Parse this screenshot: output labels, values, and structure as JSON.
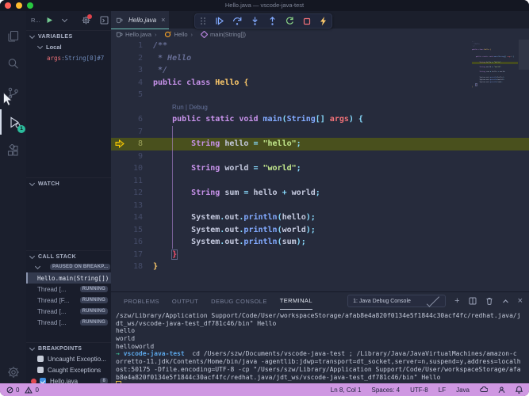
{
  "title_bar": {
    "title": "Hello.java — vscode-java-test"
  },
  "colors": {
    "status_bar_debugging": "#cf97e2",
    "active_tab_accent": "#6fc2b5",
    "current_line_highlight": "#49501d",
    "breakpoint_red": "#e04a52",
    "activity_badge_teal": "#2bbc9c"
  },
  "activity_bar": {
    "debug_badge": "1"
  },
  "sidebar": {
    "toolbar": {
      "label": "R..."
    },
    "variables": {
      "header": "VARIABLES",
      "scope_label": "Local",
      "entries": [
        {
          "name": "args",
          "sep": ": ",
          "value": "String[0]#7"
        }
      ]
    },
    "watch": {
      "header": "WATCH"
    },
    "call_stack": {
      "header": "CALL STACK",
      "session_badge": "PAUSED ON BREAKP...",
      "frame_label": "Hello.main(String[])",
      "threads": [
        {
          "label": "Thread [...",
          "status": "RUNNING"
        },
        {
          "label": "Thread [F...",
          "status": "RUNNING"
        },
        {
          "label": "Thread [...",
          "status": "RUNNING"
        },
        {
          "label": "Thread [...",
          "status": "RUNNING"
        }
      ]
    },
    "breakpoints": {
      "header": "BREAKPOINTS",
      "items": [
        {
          "label": "Uncaught Exceptio...",
          "checked": false
        },
        {
          "label": "Caught Exceptions",
          "checked": false
        },
        {
          "label": "Hello.java",
          "checked": true,
          "dot": true,
          "badge": "8"
        }
      ]
    }
  },
  "editor": {
    "tab": {
      "label": "Hello.java"
    },
    "breadcrumb": [
      "Hello.java",
      "Hello",
      "main(String[])"
    ],
    "code": {
      "lines": [
        {
          "num": 1,
          "tokens": [
            {
              "t": "/**",
              "c": "cm"
            }
          ]
        },
        {
          "num": 2,
          "tokens": [
            {
              "t": " * Hello",
              "c": "cm"
            }
          ]
        },
        {
          "num": 3,
          "tokens": [
            {
              "t": " */",
              "c": "cm"
            }
          ]
        },
        {
          "num": 4,
          "tokens": [
            {
              "t": "public class ",
              "c": "kw"
            },
            {
              "t": "Hello ",
              "c": "cls"
            },
            {
              "t": "{",
              "c": "cls"
            }
          ]
        },
        {
          "num": 5,
          "tokens": []
        },
        {
          "lens": true,
          "text": "Run | Debug"
        },
        {
          "num": 6,
          "tokens": [
            {
              "t": "    ",
              "c": "pl"
            },
            {
              "t": "public static void ",
              "c": "kw"
            },
            {
              "t": "main",
              "c": "fn"
            },
            {
              "t": "(",
              "c": "op"
            },
            {
              "t": "String",
              "c": "fn"
            },
            {
              "t": "[] ",
              "c": "op"
            },
            {
              "t": "args",
              "c": "pr"
            },
            {
              "t": ") {",
              "c": "op"
            }
          ]
        },
        {
          "num": 7,
          "tokens": []
        },
        {
          "num": 8,
          "hl": true,
          "tokens": [
            {
              "t": "        ",
              "c": "pl"
            },
            {
              "t": "String ",
              "c": "kw"
            },
            {
              "t": "hello ",
              "c": "pl"
            },
            {
              "t": "= ",
              "c": "op"
            },
            {
              "t": "\"hello\"",
              "c": "str"
            },
            {
              "t": ";",
              "c": "op"
            }
          ]
        },
        {
          "num": 9,
          "tokens": []
        },
        {
          "num": 10,
          "tokens": [
            {
              "t": "        ",
              "c": "pl"
            },
            {
              "t": "String ",
              "c": "kw"
            },
            {
              "t": "world ",
              "c": "pl"
            },
            {
              "t": "= ",
              "c": "op"
            },
            {
              "t": "\"world\"",
              "c": "str"
            },
            {
              "t": ";",
              "c": "op"
            }
          ]
        },
        {
          "num": 11,
          "tokens": []
        },
        {
          "num": 12,
          "tokens": [
            {
              "t": "        ",
              "c": "pl"
            },
            {
              "t": "String ",
              "c": "kw"
            },
            {
              "t": "sum ",
              "c": "pl"
            },
            {
              "t": "= ",
              "c": "op"
            },
            {
              "t": "hello ",
              "c": "pl"
            },
            {
              "t": "+ ",
              "c": "op"
            },
            {
              "t": "world",
              "c": "pl"
            },
            {
              "t": ";",
              "c": "op"
            }
          ]
        },
        {
          "num": 13,
          "tokens": []
        },
        {
          "num": 14,
          "tokens": [
            {
              "t": "        ",
              "c": "pl"
            },
            {
              "t": "System",
              "c": "pl"
            },
            {
              "t": ".",
              "c": "op"
            },
            {
              "t": "out",
              "c": "pl"
            },
            {
              "t": ".",
              "c": "op"
            },
            {
              "t": "println",
              "c": "fn"
            },
            {
              "t": "(",
              "c": "op"
            },
            {
              "t": "hello",
              "c": "pl"
            },
            {
              "t": ");",
              "c": "op"
            }
          ]
        },
        {
          "num": 15,
          "tokens": [
            {
              "t": "        ",
              "c": "pl"
            },
            {
              "t": "System",
              "c": "pl"
            },
            {
              "t": ".",
              "c": "op"
            },
            {
              "t": "out",
              "c": "pl"
            },
            {
              "t": ".",
              "c": "op"
            },
            {
              "t": "println",
              "c": "fn"
            },
            {
              "t": "(",
              "c": "op"
            },
            {
              "t": "world",
              "c": "pl"
            },
            {
              "t": ");",
              "c": "op"
            }
          ]
        },
        {
          "num": 16,
          "tokens": [
            {
              "t": "        ",
              "c": "pl"
            },
            {
              "t": "System",
              "c": "pl"
            },
            {
              "t": ".",
              "c": "op"
            },
            {
              "t": "out",
              "c": "pl"
            },
            {
              "t": ".",
              "c": "op"
            },
            {
              "t": "println",
              "c": "fn"
            },
            {
              "t": "(",
              "c": "op"
            },
            {
              "t": "sum",
              "c": "pl"
            },
            {
              "t": ");",
              "c": "op"
            }
          ]
        },
        {
          "num": 17,
          "tokens": [
            {
              "t": "    ",
              "c": "pl"
            },
            {
              "t": "}",
              "c": "bm"
            }
          ]
        },
        {
          "num": 18,
          "tokens": [
            {
              "t": "}",
              "c": "cls"
            }
          ]
        }
      ]
    }
  },
  "panel": {
    "tabs": [
      {
        "label": "PROBLEMS",
        "active": false
      },
      {
        "label": "OUTPUT",
        "active": false
      },
      {
        "label": "DEBUG CONSOLE",
        "active": false
      },
      {
        "label": "TERMINAL",
        "active": true
      }
    ],
    "dropdown_value": "1: Java Debug Console",
    "terminal": {
      "lines": [
        {
          "tokens": [
            {
              "t": "/szw/Library/Application Support/Code/User/workspaceStorage/afab8e4a820f0134e5f1844c30acf4fc/redhat.java/j"
            }
          ]
        },
        {
          "tokens": [
            {
              "t": "dt_ws/vscode-java-test_df781c46/bin\" Hello"
            }
          ]
        },
        {
          "tokens": [
            {
              "t": "hello"
            }
          ]
        },
        {
          "tokens": [
            {
              "t": "world"
            }
          ]
        },
        {
          "tokens": [
            {
              "t": "helloworld"
            }
          ]
        },
        {
          "tokens": [
            {
              "t": "→ ",
              "c": "grn"
            },
            {
              "t": "vscode-java-test ",
              "c": "cyn"
            },
            {
              "t": " cd /Users/szw/Documents/vscode-java-test ; /Library/Java/JavaVirtualMachines/amazon-c"
            }
          ]
        },
        {
          "tokens": [
            {
              "t": "orretto-11.jdk/Contents/Home/bin/java -agentlib:jdwp=transport=dt_socket,server=n,suspend=y,address=localh"
            }
          ]
        },
        {
          "tokens": [
            {
              "t": "ost:50175 -Dfile.encoding=UTF-8 -cp \"/Users/szw/Library/Application Support/Code/User/workspaceStorage/afa"
            }
          ]
        },
        {
          "tokens": [
            {
              "t": "b8e4a820f0134e5f1844c30acf4fc/redhat.java/jdt_ws/vscode-java-test_df781c46/bin\" Hello"
            }
          ]
        },
        {
          "tokens": [],
          "cursor": true
        }
      ]
    }
  },
  "status_bar": {
    "errors": "0",
    "warnings": "0",
    "position": "Ln 8, Col 1",
    "indent": "Spaces: 4",
    "encoding": "UTF-8",
    "eol": "LF",
    "language": "Java"
  }
}
